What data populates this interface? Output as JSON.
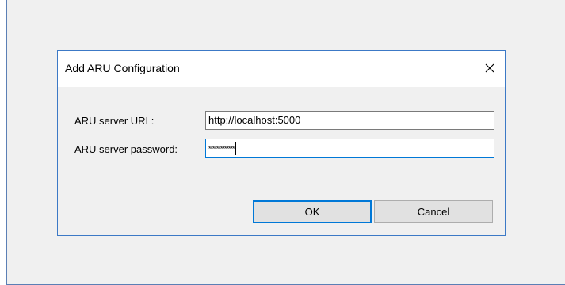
{
  "dialog": {
    "title": "Add ARU Configuration",
    "close_icon": "close-icon",
    "fields": {
      "url": {
        "label": "ARU server URL:",
        "value": "http://localhost:5000"
      },
      "password": {
        "label": "ARU server password:",
        "value": "*************"
      }
    },
    "buttons": {
      "ok": "OK",
      "cancel": "Cancel"
    }
  },
  "colors": {
    "accent": "#0078d7",
    "dialog_border": "#3c79c6",
    "background": "#f0f0f0"
  }
}
